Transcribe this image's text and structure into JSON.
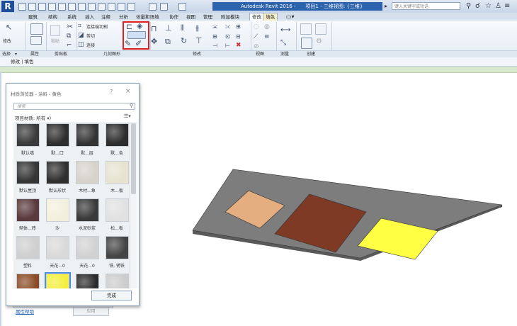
{
  "titlebar": {
    "app_name": "Autodesk Revit 2016 -",
    "project": "项目1 - 三维视图: {三维}",
    "search_placeholder": "键入关键字或短语"
  },
  "tabs": [
    "建筑",
    "结构",
    "系统",
    "插入",
    "注释",
    "分析",
    "体量和场地",
    "协作",
    "视图",
    "管理",
    "附加模块",
    "修改",
    "填色"
  ],
  "active_tabs": [
    "修改",
    "填色"
  ],
  "ribbon": {
    "panels": [
      "选择",
      "属性",
      "剪贴板",
      "几何图形",
      "修改",
      "视图",
      "测量",
      "创建"
    ],
    "tools": {
      "modify": "修改",
      "paste": "粘贴",
      "join_cut": "连接端切割",
      "cut": "剪切",
      "join": "连接"
    }
  },
  "context_bar": "修改 | 填色",
  "dialog": {
    "title": "材质浏览器 - 涂料 - 黄色",
    "help": "?",
    "close": "×",
    "search_placeholder": "搜索",
    "filter_label": "项目材质: 所有",
    "done": "完成",
    "swatches": [
      {
        "label": "默认墙",
        "color": "#3a3a3a"
      },
      {
        "label": "默...口",
        "color": "#2e2e2e"
      },
      {
        "label": "默...层",
        "color": "#333333"
      },
      {
        "label": "默...色",
        "color": "#2d2d2d"
      },
      {
        "label": "默认屋顶",
        "color": "#353535"
      },
      {
        "label": "默认形状",
        "color": "#2f2f2f"
      },
      {
        "label": "木材...象",
        "color": "#d6d3cb"
      },
      {
        "label": "木...板",
        "color": "#e6e3d0"
      },
      {
        "label": "砌体...砖",
        "color": "#5a3a3c"
      },
      {
        "label": "沙",
        "color": "#f2f0dd"
      },
      {
        "label": "水泥砂浆",
        "color": "#3a3a3a"
      },
      {
        "label": "松...板",
        "color": "#e1e1e1"
      },
      {
        "label": "塑料",
        "color": "#cfcfcf"
      },
      {
        "label": "天花...0",
        "color": "#d9d9d9"
      },
      {
        "label": "天花...0",
        "color": "#d2d2d2"
      },
      {
        "label": "铁, 锈铁",
        "color": "#444444"
      },
      {
        "label": "",
        "color": "#8a4a25"
      },
      {
        "label": "",
        "color": "#f4ef3a"
      },
      {
        "label": "",
        "color": "#2a2a2a"
      },
      {
        "label": "",
        "color": "#cccccc"
      }
    ]
  },
  "behind_dialog": {
    "help_link": "属性帮助",
    "apply": "应用"
  },
  "scene": {
    "slab_color": "#7d7d7d",
    "rect_colors": [
      "#e4ae80",
      "#7e3a25",
      "#ffff44"
    ]
  }
}
